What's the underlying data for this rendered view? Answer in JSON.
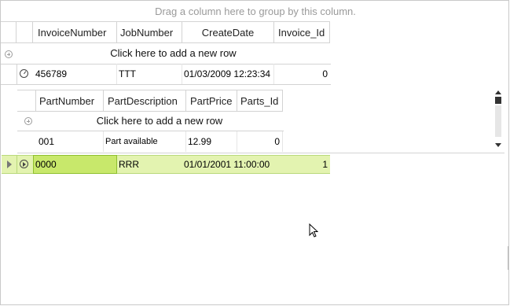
{
  "group_panel": {
    "text": "Drag a column here to group by this column."
  },
  "master": {
    "columns": [
      "InvoiceNumber",
      "JobNumber",
      "CreateDate",
      "Invoice_Id"
    ],
    "new_row_text": "Click here to add a new row",
    "rows": [
      {
        "InvoiceNumber": "456789",
        "JobNumber": "TTT",
        "CreateDate": "01/03/2009 12:23:34",
        "Invoice_Id": "0"
      },
      {
        "InvoiceNumber": "0000",
        "JobNumber": "RRR",
        "CreateDate": "01/01/2001 11:00:00",
        "Invoice_Id": "1"
      }
    ]
  },
  "detail": {
    "columns": [
      "PartNumber",
      "PartDescription",
      "PartPrice",
      "Parts_Id"
    ],
    "new_row_text": "Click here to add a new row",
    "rows": [
      {
        "PartNumber": "001",
        "PartDescription": "Part available",
        "PartPrice": "12.99",
        "Parts_Id": "0"
      }
    ]
  },
  "colors": {
    "selected_row": "#e3f3b0",
    "current_cell": "#c8e86b"
  }
}
